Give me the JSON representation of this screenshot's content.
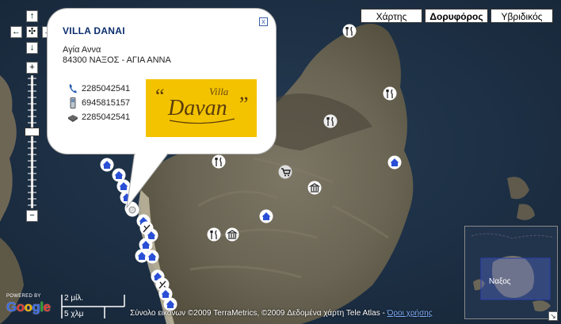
{
  "map_type_buttons": {
    "map": "Χάρτης",
    "satellite": "Δορυφόρος",
    "hybrid": "Υβριδικός",
    "active": "satellite"
  },
  "controls": {
    "pan_up": "↑",
    "pan_left": "←",
    "pan_center": "✣",
    "pan_right": "→",
    "pan_down": "↓",
    "zoom_in": "+",
    "zoom_out": "−"
  },
  "info_window": {
    "title": "VILLA DANAI",
    "address_line1": "Αγία Αννα",
    "address_line2": "84300 ΝΑΞΟΣ - ΑΓΙΑ ΑΝΝΑ",
    "phone": "2285042541",
    "mobile": "6945815157",
    "fax": "2285042541",
    "logo_text_top": "Villa",
    "logo_text_main": "Davan",
    "logo_color": "#f3c300",
    "close_symbol": "x"
  },
  "overview_map": {
    "label": "Ναξος",
    "toggle_symbol": "↘"
  },
  "branding": {
    "powered_by": "POWERED BY",
    "logo": "Google"
  },
  "scale": {
    "top_label": "2 μίλ.",
    "bottom_label": "5 χλμ"
  },
  "attribution": {
    "text": "Σύνολο εικόνων ©2009 TerraMetrics, ©2009 Δεδομένα χάρτη Tele Atlas - ",
    "terms": "Όροι χρήσης"
  },
  "colors": {
    "sea": "#22334a",
    "land": "#6f6a5c",
    "marker_house": "#2a4fd6",
    "link": "#7fb0ff"
  }
}
